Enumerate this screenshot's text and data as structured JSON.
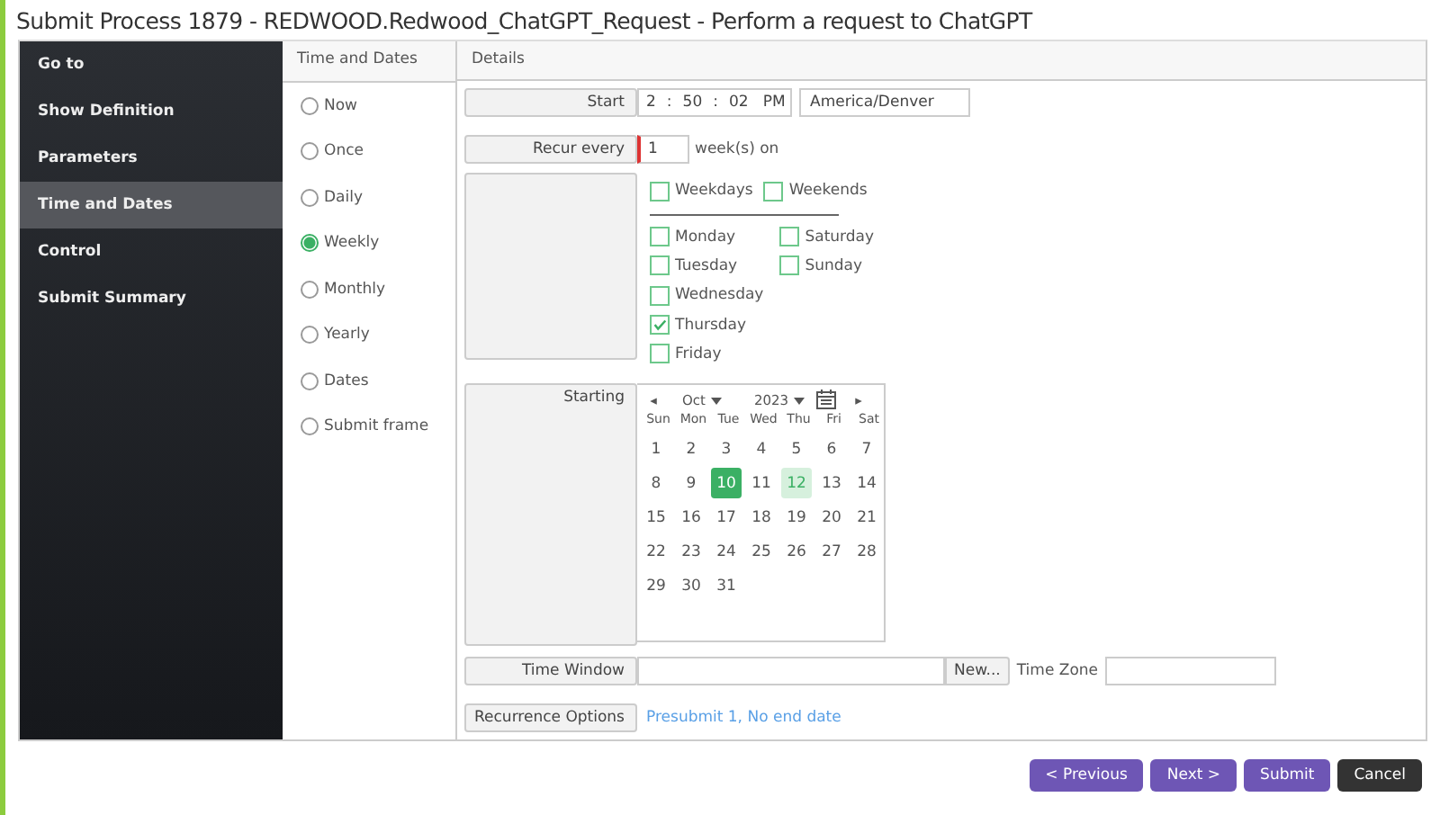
{
  "window": {
    "title": "Submit Process 1879 - REDWOOD.Redwood_ChatGPT_Request - Perform a request to ChatGPT"
  },
  "sidebar": {
    "items": [
      {
        "label": "Go to",
        "selected": false
      },
      {
        "label": "Show Definition",
        "selected": false
      },
      {
        "label": "Parameters",
        "selected": false
      },
      {
        "label": "Time and Dates",
        "selected": true
      },
      {
        "label": "Control",
        "selected": false
      },
      {
        "label": "Submit Summary",
        "selected": false
      }
    ]
  },
  "schedule_types": {
    "heading": "Time and Dates",
    "options": [
      {
        "label": "Now",
        "selected": false
      },
      {
        "label": "Once",
        "selected": false
      },
      {
        "label": "Daily",
        "selected": false
      },
      {
        "label": "Weekly",
        "selected": true
      },
      {
        "label": "Monthly",
        "selected": false
      },
      {
        "label": "Yearly",
        "selected": false
      },
      {
        "label": "Dates",
        "selected": false
      },
      {
        "label": "Submit frame",
        "selected": false
      }
    ]
  },
  "details": {
    "heading": "Details",
    "start": {
      "label": "Start",
      "hour": "2",
      "sep1": ":",
      "minute": "50",
      "sep2": ":",
      "second": "02",
      "ampm": "PM",
      "time_zone": "America/Denver"
    },
    "recur": {
      "label": "Recur every",
      "value": "1",
      "unit": "week(s) on"
    },
    "day_groups": [
      {
        "label": "Weekdays",
        "checked": false
      },
      {
        "label": "Weekends",
        "checked": false
      }
    ],
    "days_col_1": [
      {
        "label": "Monday",
        "checked": false
      },
      {
        "label": "Tuesday",
        "checked": false
      },
      {
        "label": "Wednesday",
        "checked": false
      },
      {
        "label": "Thursday",
        "checked": true
      },
      {
        "label": "Friday",
        "checked": false
      }
    ],
    "days_col_2": [
      {
        "label": "Saturday",
        "checked": false
      },
      {
        "label": "Sunday",
        "checked": false
      }
    ],
    "starting": {
      "label": "Starting",
      "prev": "◂",
      "month": "Oct",
      "year": "2023",
      "next": "▸",
      "weekdays": [
        "Sun",
        "Mon",
        "Tue",
        "Wed",
        "Thu",
        "Fri",
        "Sat"
      ],
      "weeks": [
        [
          {
            "label": "1",
            "selected": false,
            "today": false
          },
          {
            "label": "2",
            "selected": false,
            "today": false
          },
          {
            "label": "3",
            "selected": false,
            "today": false
          },
          {
            "label": "4",
            "selected": false,
            "today": false
          },
          {
            "label": "5",
            "selected": false,
            "today": false
          },
          {
            "label": "6",
            "selected": false,
            "today": false
          },
          {
            "label": "7",
            "selected": false,
            "today": false
          }
        ],
        [
          {
            "label": "8",
            "selected": false,
            "today": false
          },
          {
            "label": "9",
            "selected": false,
            "today": false
          },
          {
            "label": "10",
            "selected": true,
            "today": false
          },
          {
            "label": "11",
            "selected": false,
            "today": false
          },
          {
            "label": "12",
            "selected": false,
            "today": true
          },
          {
            "label": "13",
            "selected": false,
            "today": false
          },
          {
            "label": "14",
            "selected": false,
            "today": false
          }
        ],
        [
          {
            "label": "15",
            "selected": false,
            "today": false
          },
          {
            "label": "16",
            "selected": false,
            "today": false
          },
          {
            "label": "17",
            "selected": false,
            "today": false
          },
          {
            "label": "18",
            "selected": false,
            "today": false
          },
          {
            "label": "19",
            "selected": false,
            "today": false
          },
          {
            "label": "20",
            "selected": false,
            "today": false
          },
          {
            "label": "21",
            "selected": false,
            "today": false
          }
        ],
        [
          {
            "label": "22",
            "selected": false,
            "today": false
          },
          {
            "label": "23",
            "selected": false,
            "today": false
          },
          {
            "label": "24",
            "selected": false,
            "today": false
          },
          {
            "label": "25",
            "selected": false,
            "today": false
          },
          {
            "label": "26",
            "selected": false,
            "today": false
          },
          {
            "label": "27",
            "selected": false,
            "today": false
          },
          {
            "label": "28",
            "selected": false,
            "today": false
          }
        ],
        [
          {
            "label": "29",
            "selected": false,
            "today": false
          },
          {
            "label": "30",
            "selected": false,
            "today": false
          },
          {
            "label": "31",
            "selected": false,
            "today": false
          }
        ]
      ]
    },
    "time_window": {
      "label": "Time Window",
      "button": "New...",
      "time_zone_label": "Time Zone"
    },
    "recurrence_options": {
      "label": "Recurrence Options",
      "link": "Presubmit 1, No end date"
    }
  },
  "buttons": [
    {
      "label": "< Previous",
      "kind": "nav"
    },
    {
      "label": "Next >",
      "kind": "nav"
    },
    {
      "label": "Submit",
      "kind": "nav"
    },
    {
      "label": "Cancel",
      "kind": "cancel"
    }
  ]
}
